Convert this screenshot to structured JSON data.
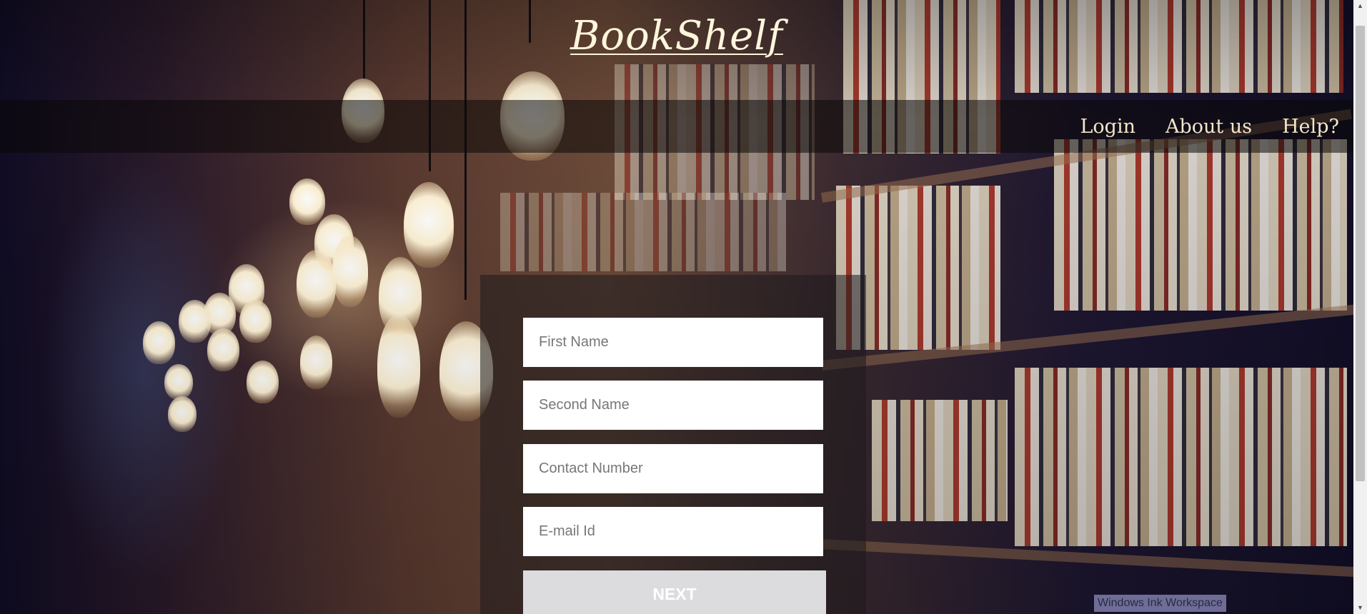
{
  "header": {
    "logo_text": "BookShelf"
  },
  "nav": {
    "items": [
      "Login",
      "About us",
      "Help?"
    ]
  },
  "form": {
    "fields": [
      {
        "placeholder": "First Name",
        "value": ""
      },
      {
        "placeholder": "Second Name",
        "value": ""
      },
      {
        "placeholder": "Contact Number",
        "value": ""
      },
      {
        "placeholder": "E-mail Id",
        "value": ""
      }
    ],
    "next_label": "NEXT"
  },
  "overlay": {
    "ink_workspace_label": "Windows Ink Workspace"
  },
  "icons": {
    "scroll_up": "chevron-up-icon",
    "scroll_down": "chevron-down-icon"
  },
  "colors": {
    "logo": "#fff6dc",
    "nav_text": "#f2e6c8",
    "button_bg": "#dcdcdf"
  }
}
